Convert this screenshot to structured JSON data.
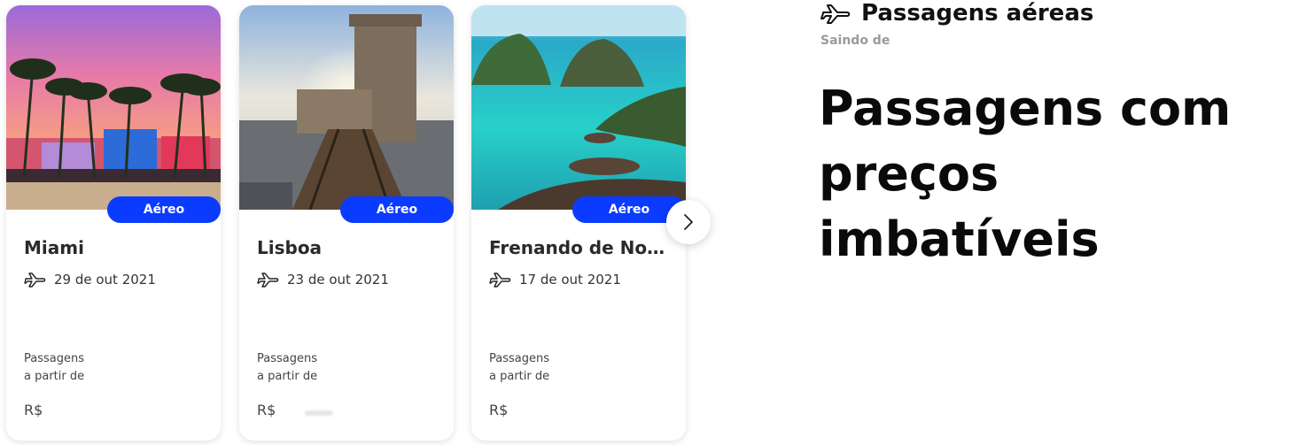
{
  "cards": [
    {
      "destination": "Miami",
      "badge": "Aéreo",
      "date": "29 de out 2021",
      "from_line1": "Passagens",
      "from_line2": "a partir de",
      "currency": "R$"
    },
    {
      "destination": "Lisboa",
      "badge": "Aéreo",
      "date": "23 de out 2021",
      "from_line1": "Passagens",
      "from_line2": "a partir de",
      "currency": "R$"
    },
    {
      "destination": "Frenando de Noronha",
      "badge": "Aéreo",
      "date": "17 de out 2021",
      "from_line1": "Passagens",
      "from_line2": "a partir de",
      "currency": "R$"
    }
  ],
  "carousel": {
    "next_icon": "chevron-right-icon"
  },
  "hero": {
    "icon": "airplane-icon",
    "title": "Passagens aéreas",
    "subtitle": "Saindo de",
    "headline": "Passagens com preços imbatíveis"
  },
  "colors": {
    "accent": "#0b3bff"
  }
}
